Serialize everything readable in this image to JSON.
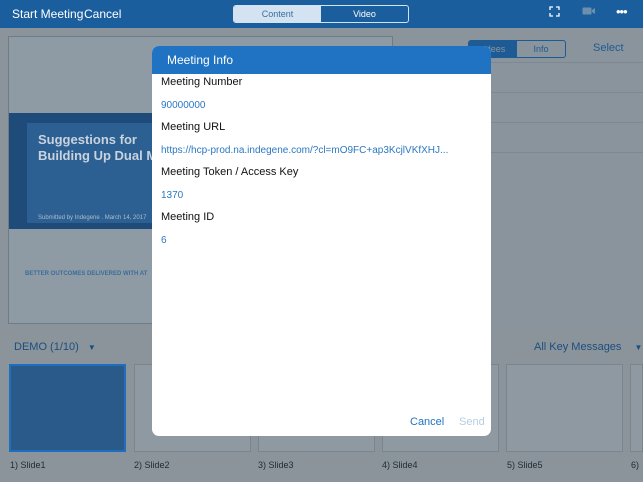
{
  "topbar": {
    "title": "Start Meeting",
    "cancel": "Cancel",
    "segments": [
      "Content",
      "Video"
    ],
    "icons": [
      "expand-icon",
      "camera-icon",
      "more-icon"
    ]
  },
  "background": {
    "slide": {
      "title": "Suggestions for Building Up Dual M",
      "subtitle": "Submitted by Indegene . March 14, 2017",
      "footer": "BETTER OUTCOMES DELIVERED WITH AT"
    },
    "panel": {
      "tabs": [
        "ndees",
        "Info"
      ],
      "select": "Select"
    },
    "strip": {
      "deck": "DEMO  (1/10)",
      "filter": "All Key Messages",
      "slides": [
        "1) Slide1",
        "2) Slide2",
        "3) Slide3",
        "4) Slide4",
        "5) Slide5",
        "6)"
      ]
    }
  },
  "dialog": {
    "title": "Meeting Info",
    "fields": [
      {
        "label": "Meeting Number",
        "value": "90000000"
      },
      {
        "label": "Meeting URL",
        "value": "https://hcp-prod.na.indegene.com/?cl=mO9FC+ap3KcjlVKfXHJ..."
      },
      {
        "label": "Meeting Token / Access Key",
        "value": "1370"
      },
      {
        "label": "Meeting ID",
        "value": "6"
      }
    ],
    "cancel": "Cancel",
    "send": "Send"
  },
  "colors": {
    "accent": "#1f73c2",
    "topbar": "#1a5e9e",
    "value_text": "#2b78c2",
    "disabled": "#b7cce0"
  }
}
